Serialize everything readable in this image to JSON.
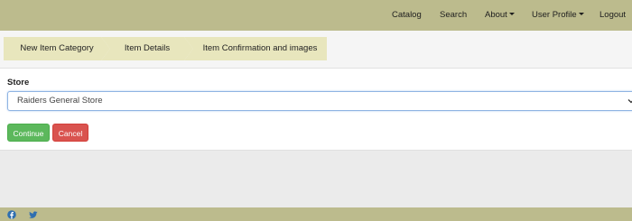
{
  "navbar": {
    "catalog": "Catalog",
    "search": "Search",
    "about": "About",
    "user_profile": "User Profile",
    "logout": "Logout"
  },
  "steps": {
    "step1": "New Item Category",
    "step2": "Item Details",
    "step3": "Item Confirmation and images"
  },
  "form": {
    "store_label": "Store",
    "store_value": "Raiders General Store"
  },
  "buttons": {
    "continue": "Continue",
    "cancel": "Cancel"
  },
  "footer": {
    "icons": [
      "facebook-icon",
      "twitter-icon"
    ]
  },
  "colors": {
    "navbar": "#bcbb8d",
    "step": "#e8e6bd",
    "continue": "#5cb85c",
    "cancel": "#d9534f",
    "social_icon": "#2f6fb0"
  }
}
